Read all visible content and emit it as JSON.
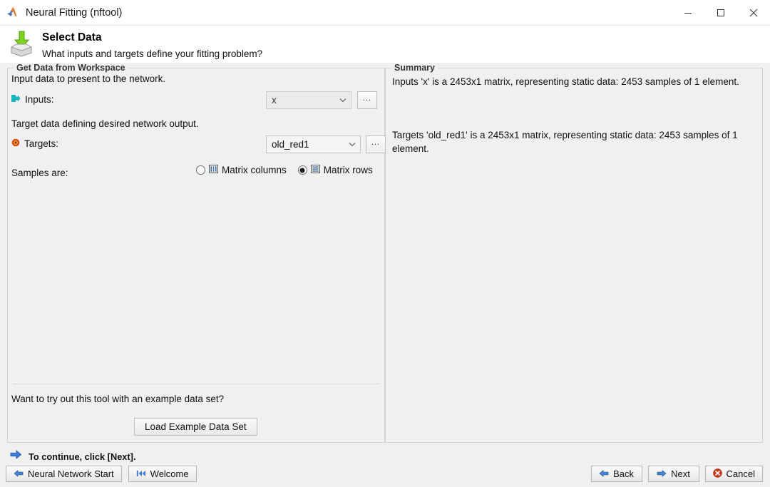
{
  "window": {
    "title": "Neural Fitting (nftool)",
    "app_icon": "matlab-membrane-icon",
    "controls": {
      "minimize": "minimize-icon",
      "maximize": "maximize-icon",
      "close": "close-icon"
    }
  },
  "header": {
    "icon": "import-data-icon",
    "title": "Select Data",
    "subtitle": "What inputs and targets define your fitting problem?"
  },
  "left_panel": {
    "legend": "Get Data from Workspace",
    "inputs_desc": "Input data to present to the network.",
    "inputs_label": "Inputs:",
    "inputs_icon": "input-port-icon",
    "inputs_value": "x",
    "inputs_browse": "...",
    "targets_desc": "Target data defining desired network output.",
    "targets_label": "Targets:",
    "targets_icon": "target-bullseye-icon",
    "targets_value": "old_red1",
    "targets_browse": "...",
    "samples_label": "Samples are:",
    "samples_options": [
      {
        "label": "Matrix columns",
        "icon": "matrix-columns-icon",
        "selected": false
      },
      {
        "label": "Matrix rows",
        "icon": "matrix-rows-icon",
        "selected": true
      }
    ],
    "example_prompt": "Want to try out this tool with an example data set?",
    "example_button": "Load Example Data Set"
  },
  "right_panel": {
    "legend": "Summary",
    "paragraphs": [
      "Inputs 'x' is a 2453x1 matrix, representing static data: 2453 samples of 1 element.",
      "Targets 'old_red1' is a 2453x1 matrix, representing static data: 2453 samples of 1 element."
    ]
  },
  "bottom": {
    "continue_icon": "blue-right-arrow-icon",
    "continue_text": "To continue, click [Next].",
    "nn_start_button": "Neural Network Start",
    "nn_start_icon": "blue-left-arrow-icon",
    "welcome_button": "Welcome",
    "welcome_icon": "skip-to-start-icon",
    "back_button": "Back",
    "back_icon": "blue-left-arrow-icon",
    "next_button": "Next",
    "next_icon": "blue-right-arrow-icon",
    "cancel_button": "Cancel",
    "cancel_icon": "red-cancel-icon"
  },
  "colors": {
    "window_bg": "#f0f0f0",
    "titlebar_bg": "#ffffff",
    "border": "#d2d2d2",
    "input_accent": "#17b5c0",
    "target_accent": "#c8401a",
    "arrow_blue": "#2f6fc0",
    "cancel_red": "#cc2b18",
    "icon_green": "#6cc028"
  }
}
